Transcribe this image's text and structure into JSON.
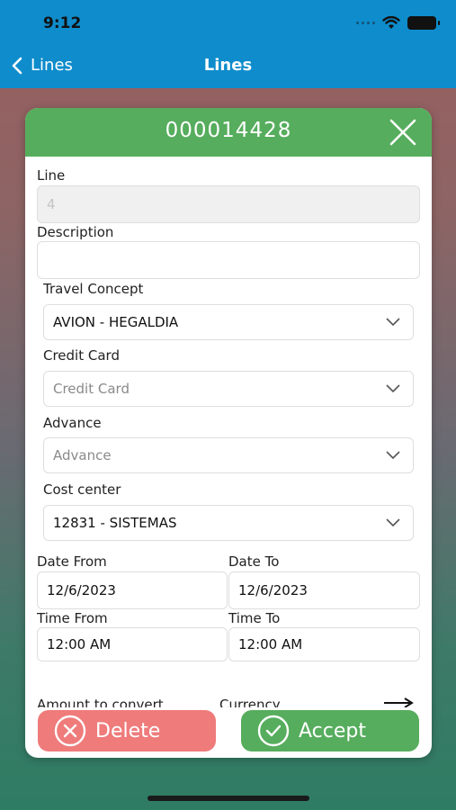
{
  "status_bar": {
    "time": "9:12"
  },
  "nav": {
    "back_label": "Lines",
    "title": "Lines"
  },
  "modal": {
    "title": "000014428",
    "line": {
      "label": "Line",
      "value": "4"
    },
    "description": {
      "label": "Description",
      "value": ""
    },
    "travel_concept": {
      "label": "Travel Concept",
      "value": "AVION - HEGALDIA"
    },
    "credit_card": {
      "label": "Credit Card",
      "placeholder": "Credit Card"
    },
    "advance": {
      "label": "Advance",
      "placeholder": "Advance"
    },
    "cost_center": {
      "label": "Cost center",
      "value": "12831 - SISTEMAS"
    },
    "date_from": {
      "label": "Date From",
      "value": "12/6/2023"
    },
    "date_to": {
      "label": "Date To",
      "value": "12/6/2023"
    },
    "time_from": {
      "label": "Time From",
      "value": "12:00 AM"
    },
    "time_to": {
      "label": "Time To",
      "value": "12:00 AM"
    },
    "amount_to_convert": {
      "label": "Amount to convert"
    },
    "currency": {
      "label": "Currency"
    },
    "delete_label": "Delete",
    "accept_label": "Accept"
  },
  "icons": {
    "back": "chevron-left-icon",
    "close": "close-icon",
    "dropdown": "chevron-down-icon",
    "delete": "x-circle-icon",
    "accept": "check-circle-icon",
    "convert": "arrow-right-icon"
  },
  "colors": {
    "topbar": "#0e8ccc",
    "header_green": "#56ad5d",
    "delete_red": "#ef7b7b",
    "accept_green": "#56ad5d"
  }
}
